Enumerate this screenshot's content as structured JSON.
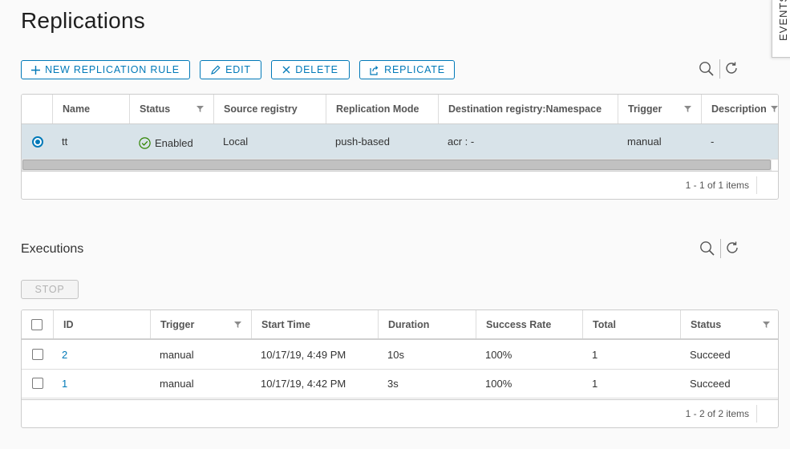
{
  "page": {
    "title": "Replications"
  },
  "events_tab": {
    "label": "EVENTS"
  },
  "toolbar": {
    "new_rule": "NEW REPLICATION RULE",
    "edit": "EDIT",
    "delete": "DELETE",
    "replicate": "REPLICATE"
  },
  "rules": {
    "columns": [
      "Name",
      "Status",
      "Source registry",
      "Replication Mode",
      "Destination registry:Namespace",
      "Trigger",
      "Description"
    ],
    "rows": [
      {
        "name": "tt",
        "status": "Enabled",
        "source": "Local",
        "mode": "push-based",
        "destination": "acr : -",
        "trigger": "manual",
        "description": "-"
      }
    ],
    "footer": "1 - 1 of 1 items"
  },
  "executions": {
    "title": "Executions",
    "stop": "STOP",
    "columns": [
      "ID",
      "Trigger",
      "Start Time",
      "Duration",
      "Success Rate",
      "Total",
      "Status"
    ],
    "rows": [
      {
        "id": "2",
        "trigger": "manual",
        "start": "10/17/19, 4:49 PM",
        "duration": "10s",
        "rate": "100%",
        "total": "1",
        "status": "Succeed"
      },
      {
        "id": "1",
        "trigger": "manual",
        "start": "10/17/19, 4:42 PM",
        "duration": "3s",
        "rate": "100%",
        "total": "1",
        "status": "Succeed"
      }
    ],
    "footer": "1 - 2 of 2 items"
  },
  "colors": {
    "accent": "#0079b8",
    "success": "#2f8400",
    "selected_row": "#d8e3e9"
  },
  "icons": [
    "plus-icon",
    "pencil-icon",
    "close-icon",
    "replicate-icon",
    "search-icon",
    "refresh-icon",
    "filter-icon",
    "check-circle-icon"
  ]
}
